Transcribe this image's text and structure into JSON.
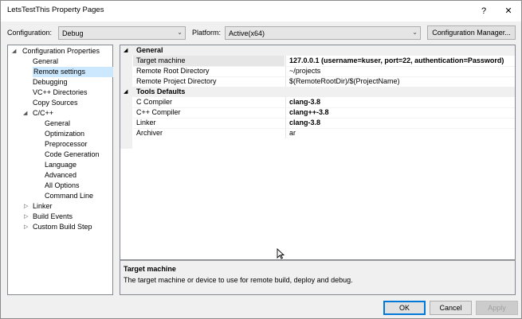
{
  "window": {
    "title": "LetsTestThis Property Pages",
    "help_glyph": "?",
    "close_glyph": "✕"
  },
  "config": {
    "configuration_label": "Configuration:",
    "configuration_value": "Debug",
    "platform_label": "Platform:",
    "platform_value": "Active(x64)",
    "manager_button": "Configuration Manager..."
  },
  "tree": {
    "root": "Configuration Properties",
    "items": [
      "General",
      "Remote settings",
      "Debugging",
      "VC++ Directories",
      "Copy Sources"
    ],
    "cpp": {
      "label": "C/C++",
      "children": [
        "General",
        "Optimization",
        "Preprocessor",
        "Code Generation",
        "Language",
        "Advanced",
        "All Options",
        "Command Line"
      ]
    },
    "collapsed": [
      "Linker",
      "Build Events",
      "Custom Build Step"
    ],
    "selected": "Remote settings"
  },
  "grid": {
    "general": {
      "label": "General",
      "props": [
        {
          "name": "Target machine",
          "value": "127.0.0.1 (username=kuser, port=22, authentication=Password)"
        },
        {
          "name": "Remote Root Directory",
          "value": "~/projects"
        },
        {
          "name": "Remote Project Directory",
          "value": "$(RemoteRootDir)/$(ProjectName)"
        }
      ]
    },
    "tools": {
      "label": "Tools Defaults",
      "props": [
        {
          "name": "C Compiler",
          "value": "clang-3.8"
        },
        {
          "name": "C++ Compiler",
          "value": "clang++-3.8"
        },
        {
          "name": "Linker",
          "value": "clang-3.8"
        },
        {
          "name": "Archiver",
          "value": "ar"
        }
      ]
    }
  },
  "description": {
    "title": "Target machine",
    "text": "The target machine or device to use for remote build, deploy and debug."
  },
  "buttons": {
    "ok": "OK",
    "cancel": "Cancel",
    "apply": "Apply"
  },
  "colors": {
    "selection": "#cce8ff",
    "accent": "#0078d7"
  }
}
